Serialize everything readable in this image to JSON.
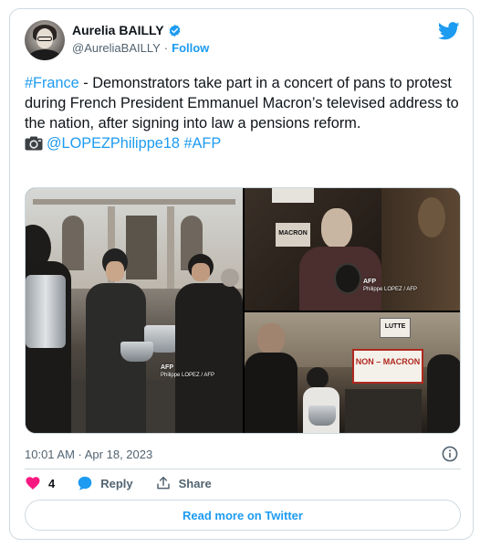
{
  "author": {
    "display_name": "Aurelia BAILLY",
    "handle": "@AureliaBAILLY",
    "separator": "·",
    "follow_label": "Follow"
  },
  "tweet": {
    "hashtag_france": "#France",
    "text_main": " - Demonstrators take part in a concert of pans to protest during French President Emmanuel Macron’s televised address to the nation, after signing into law a pensions reform.",
    "photo_credit_mention": "@LOPEZPhilippe18",
    "hashtag_afp": "#AFP"
  },
  "media": {
    "watermark_brand": "AFP",
    "watermark_credit": "Philippe LOPEZ / AFP",
    "sign_macron_top": "MACRON",
    "sign_lutte": "LUTTE",
    "sign_non_macron": "NON – MACRON"
  },
  "footer": {
    "timestamp": "10:01 AM · Apr 18, 2023",
    "like_count": "4",
    "reply_label": "Reply",
    "share_label": "Share",
    "read_more_label": "Read more on Twitter"
  },
  "colors": {
    "brand_blue": "#1d9bf0",
    "like_pink": "#f91880",
    "text_secondary": "#536471",
    "border": "#cfd9de"
  },
  "icons": [
    "verified-badge-icon",
    "twitter-bird-icon",
    "camera-icon",
    "info-icon",
    "heart-icon",
    "reply-bubble-icon",
    "share-icon"
  ]
}
